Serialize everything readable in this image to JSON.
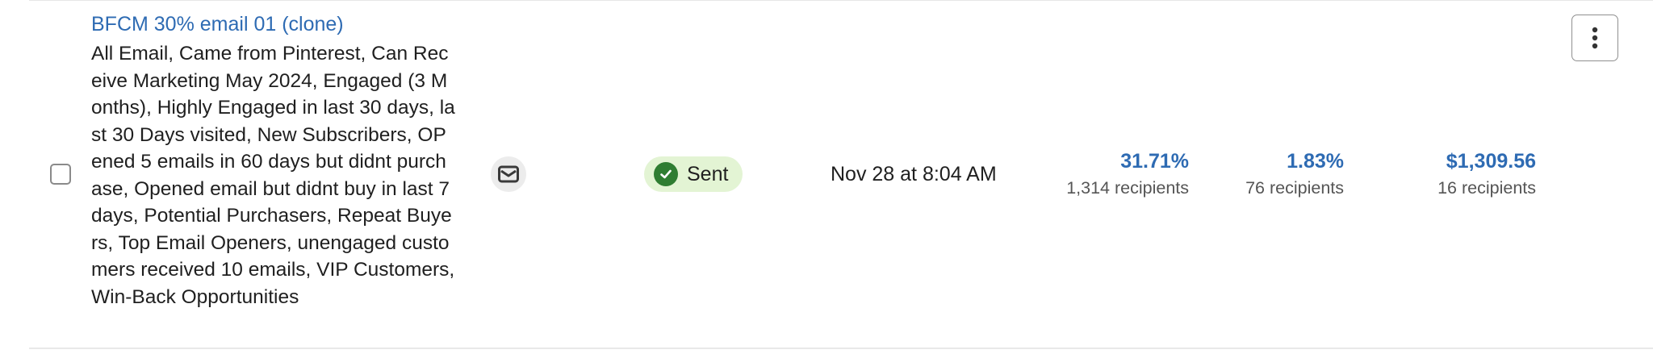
{
  "campaign": {
    "name": "BFCM 30% email 01 (clone)",
    "lists": "All Email, Came from Pinterest, Can Receive Marketing May 2024, Engaged (3 Months), Highly Engaged in last 30 days, last 30 Days visited, New Subscribers, OPened 5 emails in 60 days but didnt purchase, Opened email but didnt buy in last 7 days, Potential Purchasers, Repeat Buyers, Top Email Openers, unengaged customers received 10 emails, VIP Customers, Win-Back Opportunities",
    "channel_icon": "mail-icon",
    "status": "Sent",
    "status_color": "#2f7d32",
    "status_bg": "#e3f4d4",
    "send_date": "Nov 28 at 8:04 AM"
  },
  "metrics": [
    {
      "value": "31.71%",
      "sub": "1,314 recipients"
    },
    {
      "value": "1.83%",
      "sub": "76 recipients"
    },
    {
      "value": "$1,309.56",
      "sub": "16 recipients"
    }
  ],
  "colors": {
    "link": "#2e6bb3"
  }
}
